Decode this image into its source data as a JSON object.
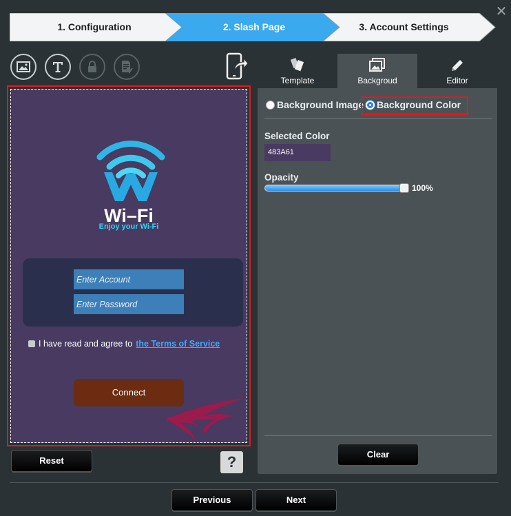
{
  "window": {
    "close_label": "✕"
  },
  "stepper": {
    "steps": [
      {
        "label": "1. Configuration",
        "active": false
      },
      {
        "label": "2. Slash Page",
        "active": true
      },
      {
        "label": "3. Account Settings",
        "active": false
      }
    ],
    "colors": {
      "inactive": "#f2f4f5",
      "active": "#3aa9ee"
    }
  },
  "toolbar": {
    "tools": [
      {
        "name": "image-icon",
        "enabled": true
      },
      {
        "name": "text-icon",
        "enabled": true
      },
      {
        "name": "lock-icon",
        "enabled": false
      },
      {
        "name": "document-edit-icon",
        "enabled": false
      }
    ],
    "preview_icon": "mobile-share-icon"
  },
  "preview": {
    "background_color": "#483A61",
    "title": "Wi–Fi",
    "subtitle": "Enjoy your Wi-Fi",
    "account_placeholder": "Enter Account",
    "password_placeholder": "Enter Password",
    "agree_text": "I have read and agree to",
    "terms_link": "the Terms of Service",
    "connect_label": "Connect"
  },
  "left_actions": {
    "reset_label": "Reset",
    "help_label": "?"
  },
  "tabs": [
    {
      "label": "Template",
      "icon": "template-icon",
      "active": false
    },
    {
      "label": "Backgroud",
      "icon": "background-image-icon",
      "active": true
    },
    {
      "label": "Editor",
      "icon": "pencil-icon",
      "active": false
    }
  ],
  "background_panel": {
    "option_image_label": "Background Image",
    "option_color_label": "Background Color",
    "selected_option": "Background Color",
    "selected_color_label": "Selected Color",
    "selected_color_value": "483A61",
    "opacity_label": "Opacity",
    "opacity_value": "100%",
    "opacity_fraction": 1.0,
    "clear_label": "Clear"
  },
  "footer": {
    "previous_label": "Previous",
    "next_label": "Next"
  }
}
